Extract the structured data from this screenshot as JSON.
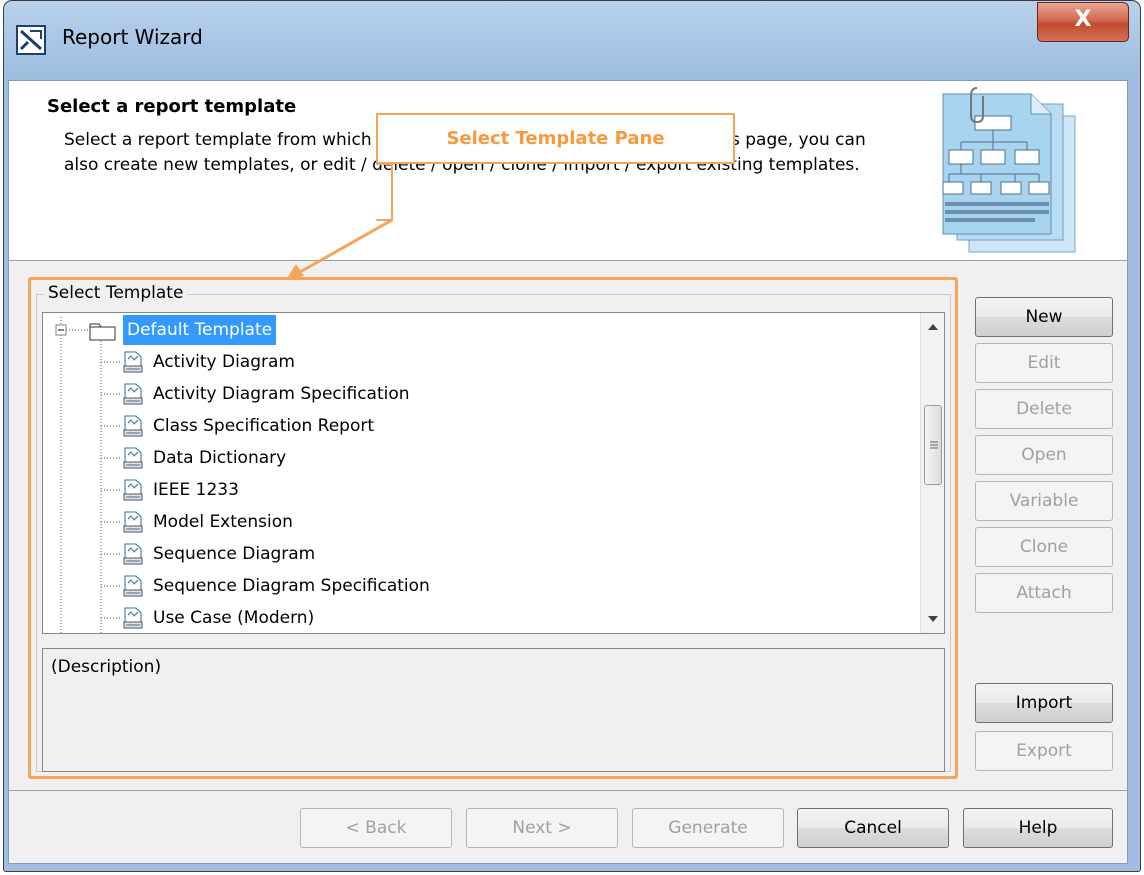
{
  "window": {
    "title": "Report Wizard",
    "close_glyph": "X"
  },
  "header": {
    "title": "Select a report template",
    "description": "Select a report template from which you would like to generate a report. In this page, you can also create new templates, or edit / delete / open / clone / import / export existing templates."
  },
  "callout": {
    "text": "Select Template Pane",
    "color": "#f5a55a"
  },
  "group": {
    "label": "Select Template"
  },
  "tree": {
    "root": {
      "label": "Default Template",
      "icon": "folder-icon",
      "expanded": true,
      "selected": true
    },
    "items": [
      {
        "label": "Activity Diagram",
        "icon": "report-template-icon"
      },
      {
        "label": "Activity Diagram Specification",
        "icon": "report-template-icon"
      },
      {
        "label": "Class Specification Report",
        "icon": "report-template-icon"
      },
      {
        "label": "Data Dictionary",
        "icon": "report-template-icon"
      },
      {
        "label": "IEEE 1233",
        "icon": "report-template-icon"
      },
      {
        "label": "Model Extension",
        "icon": "report-template-icon"
      },
      {
        "label": "Sequence Diagram",
        "icon": "report-template-icon"
      },
      {
        "label": "Sequence Diagram Specification",
        "icon": "report-template-icon"
      },
      {
        "label": "Use Case (Modern)",
        "icon": "report-template-icon"
      }
    ]
  },
  "description": {
    "text": "(Description)"
  },
  "side_buttons": [
    {
      "label": "New",
      "enabled": true
    },
    {
      "label": "Edit",
      "enabled": false
    },
    {
      "label": "Delete",
      "enabled": false
    },
    {
      "label": "Open",
      "enabled": false
    },
    {
      "label": "Variable",
      "enabled": false
    },
    {
      "label": "Clone",
      "enabled": false
    },
    {
      "label": "Attach",
      "enabled": false
    }
  ],
  "io_buttons": [
    {
      "label": "Import",
      "enabled": true
    },
    {
      "label": "Export",
      "enabled": false
    }
  ],
  "footer_buttons": [
    {
      "label": "< Back",
      "enabled": false
    },
    {
      "label": "Next >",
      "enabled": false
    },
    {
      "label": "Generate",
      "enabled": false
    },
    {
      "label": "Cancel",
      "enabled": true
    },
    {
      "label": "Help",
      "enabled": true
    }
  ],
  "colors": {
    "selection": "#3399ff",
    "accent_orange": "#f5a55a",
    "close_red": "#c94a30"
  }
}
